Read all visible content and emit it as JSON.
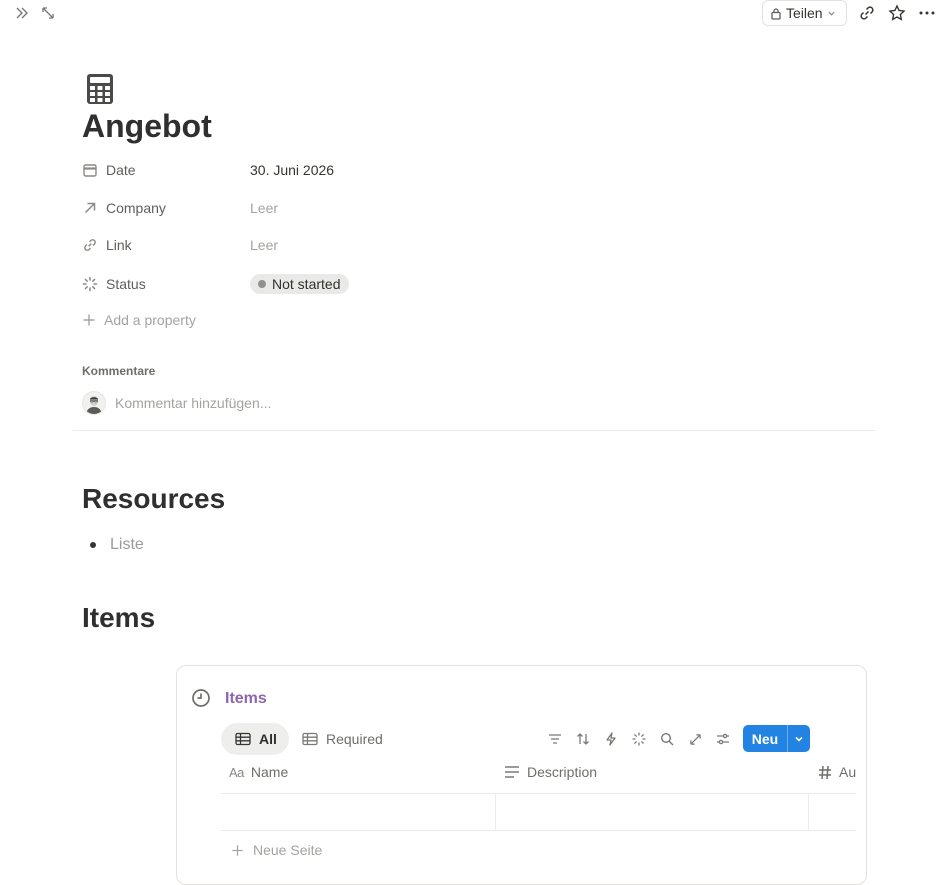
{
  "topbar": {
    "share_label": "Teilen"
  },
  "page": {
    "icon": "calculator-icon",
    "title": "Angebot"
  },
  "properties": [
    {
      "label": "Date",
      "icon": "calendar-icon",
      "value": "30. Juni 2026",
      "empty": false
    },
    {
      "label": "Company",
      "icon": "arrow-up-right-icon",
      "value": "Leer",
      "empty": true
    },
    {
      "label": "Link",
      "icon": "link-icon",
      "value": "Leer",
      "empty": true
    },
    {
      "label": "Status",
      "icon": "status-spinner-icon",
      "value": "Not started",
      "empty": false
    }
  ],
  "add_property_label": "Add a property",
  "comments": {
    "title": "Kommentare",
    "placeholder": "Kommentar hinzufügen..."
  },
  "resources": {
    "heading": "Resources",
    "items": [
      "Liste"
    ]
  },
  "items_section": {
    "heading": "Items"
  },
  "database": {
    "title": "Items",
    "views": [
      {
        "label": "All",
        "active": true
      },
      {
        "label": "Required",
        "active": false
      }
    ],
    "new_button_label": "Neu",
    "columns": [
      {
        "label": "Name",
        "icon": "text-aa-icon"
      },
      {
        "label": "Description",
        "icon": "lines-icon"
      },
      {
        "label": "Au",
        "icon": "hash-icon"
      }
    ],
    "new_page_label": "Neue Seite"
  },
  "colors": {
    "accent": "#2383e2",
    "db_title": "#9065b0",
    "status_pill": "#e9e9e7"
  }
}
